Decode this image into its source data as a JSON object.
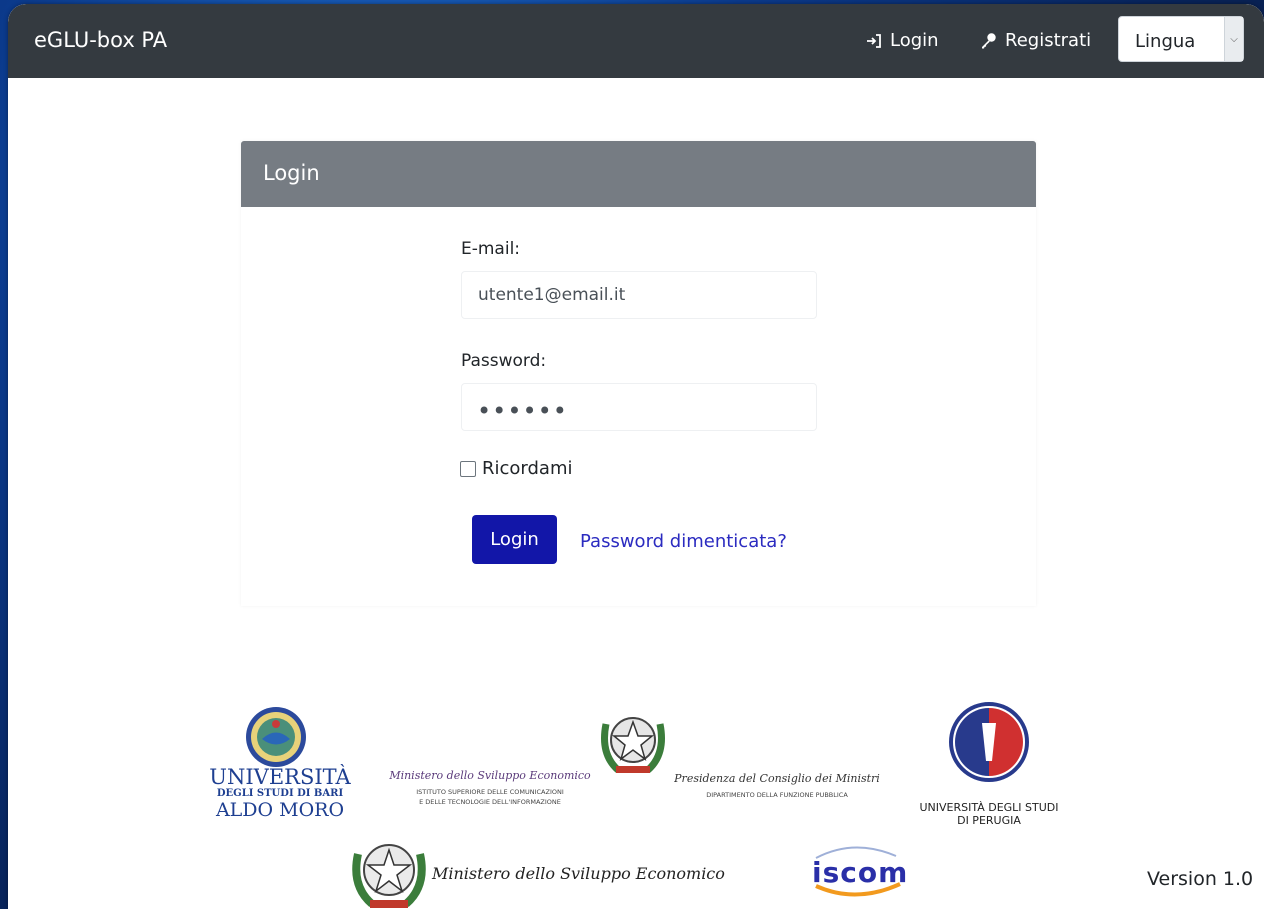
{
  "navbar": {
    "brand": "eGLU-box PA",
    "login_label": "Login",
    "register_label": "Registrati",
    "language_select": "Lingua"
  },
  "login_card": {
    "header": "Login",
    "email_label": "E-mail:",
    "email_value": "utente1@email.it",
    "password_label": "Password:",
    "password_value": "••••••",
    "remember_label": "Ricordami",
    "submit_label": "Login",
    "forgot_label": "Password dimenticata?"
  },
  "footer": {
    "logos": {
      "uniba": {
        "line1": "UNIVERSITÀ",
        "line2": "DEGLI STUDI DI BARI",
        "line3": "ALDO MORO"
      },
      "mise_iscom": {
        "script": "Ministero dello Sviluppo Economico",
        "line1": "ISTITUTO SUPERIORE DELLE COMUNICAZIONI",
        "line2": "E DELLE TECNOLOGIE DELL'INFORMAZIONE"
      },
      "presidenza": {
        "script": "Presidenza del Consiglio dei Ministri",
        "line1": "DIPARTIMENTO DELLA FUNZIONE PUBBLICA"
      },
      "unipg": {
        "line1": "UNIVERSITÀ DEGLI STUDI",
        "line2": "DI PERUGIA"
      },
      "mise": {
        "script": "Ministero dello Sviluppo Economico"
      },
      "iscom": {
        "text": "iscom"
      }
    },
    "version": "Version 1.0"
  },
  "colors": {
    "navbar": "#343a40",
    "card_header": "#767c83",
    "primary_button": "#1216a8",
    "link": "#2b2bc0",
    "iscom_blue": "#2a2fa8",
    "iscom_orange": "#f29a1e"
  }
}
